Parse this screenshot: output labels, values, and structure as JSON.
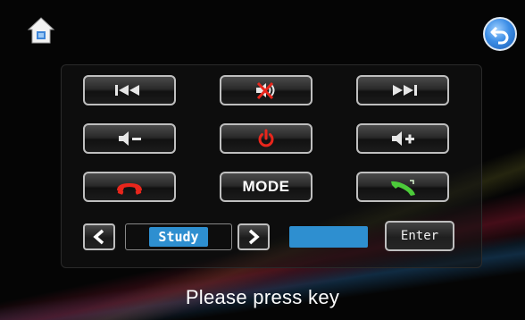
{
  "nav": {
    "home_icon": "home-icon",
    "back_icon": "back-arrow-icon"
  },
  "keys": {
    "prev": {
      "icon": "skip-previous-icon",
      "glyph": "I◀◀"
    },
    "mute": {
      "icon": "mute-icon"
    },
    "next": {
      "icon": "skip-next-icon",
      "glyph": "▶▶I"
    },
    "vol_down": {
      "icon": "volume-down-icon"
    },
    "power": {
      "icon": "power-icon",
      "color": "#e8261c"
    },
    "vol_up": {
      "icon": "volume-up-icon"
    },
    "hang_up": {
      "icon": "hang-up-icon",
      "color": "#e8261c"
    },
    "mode_label": "MODE",
    "answer": {
      "icon": "call-answer-icon",
      "color": "#4ccb3a"
    }
  },
  "selector": {
    "prev_icon": "chevron-left-icon",
    "value": "Study",
    "next_icon": "chevron-right-icon",
    "input_value": "",
    "enter_label": "Enter"
  },
  "status": {
    "message": "Please press key"
  },
  "colors": {
    "accent_blue": "#2e8fd0",
    "red": "#e8261c",
    "green": "#4ccb3a"
  }
}
